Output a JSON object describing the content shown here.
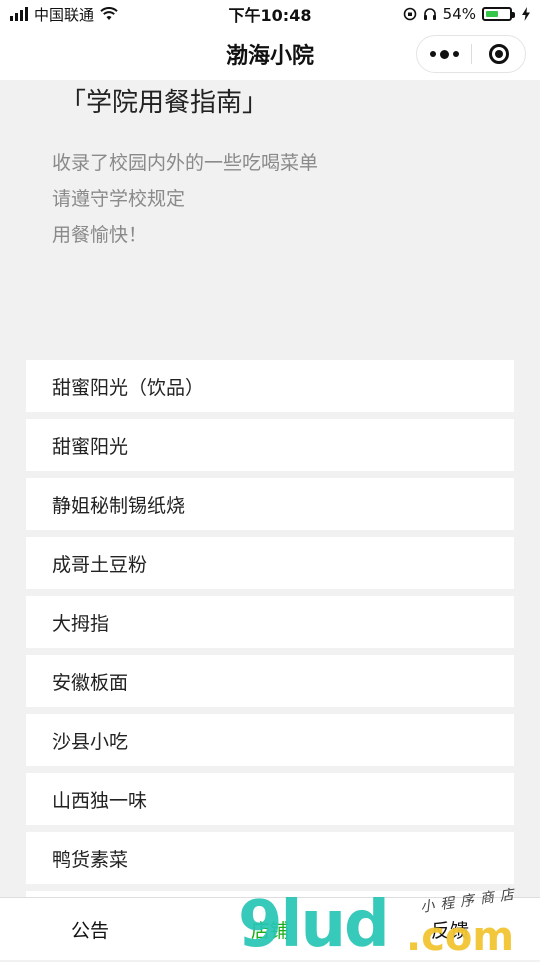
{
  "status_bar": {
    "carrier": "中国联通",
    "time": "下午10:48",
    "battery_percent": "54%",
    "battery_level": 0.54,
    "battery_color": "#35c64a"
  },
  "nav": {
    "title": "渤海小院"
  },
  "intro": {
    "title": "「学院用餐指南」",
    "lines": [
      "收录了校园内外的一些吃喝菜单",
      "请遵守学校规定",
      "用餐愉快！"
    ]
  },
  "list": {
    "items": [
      "甜蜜阳光（饮品）",
      "甜蜜阳光",
      "静姐秘制锡纸烧",
      "成哥土豆粉",
      "大拇指",
      "安徽板面",
      "沙县小吃",
      "山西独一味",
      "鸭货素菜"
    ]
  },
  "tabs": [
    {
      "label": "公告",
      "active": false
    },
    {
      "label": "店铺",
      "active": true
    },
    {
      "label": "反馈",
      "active": false
    }
  ],
  "accent_color": "#1aad19",
  "watermark": {
    "main": "9lud",
    "suffix": ".com",
    "sub": "小程序商店"
  }
}
